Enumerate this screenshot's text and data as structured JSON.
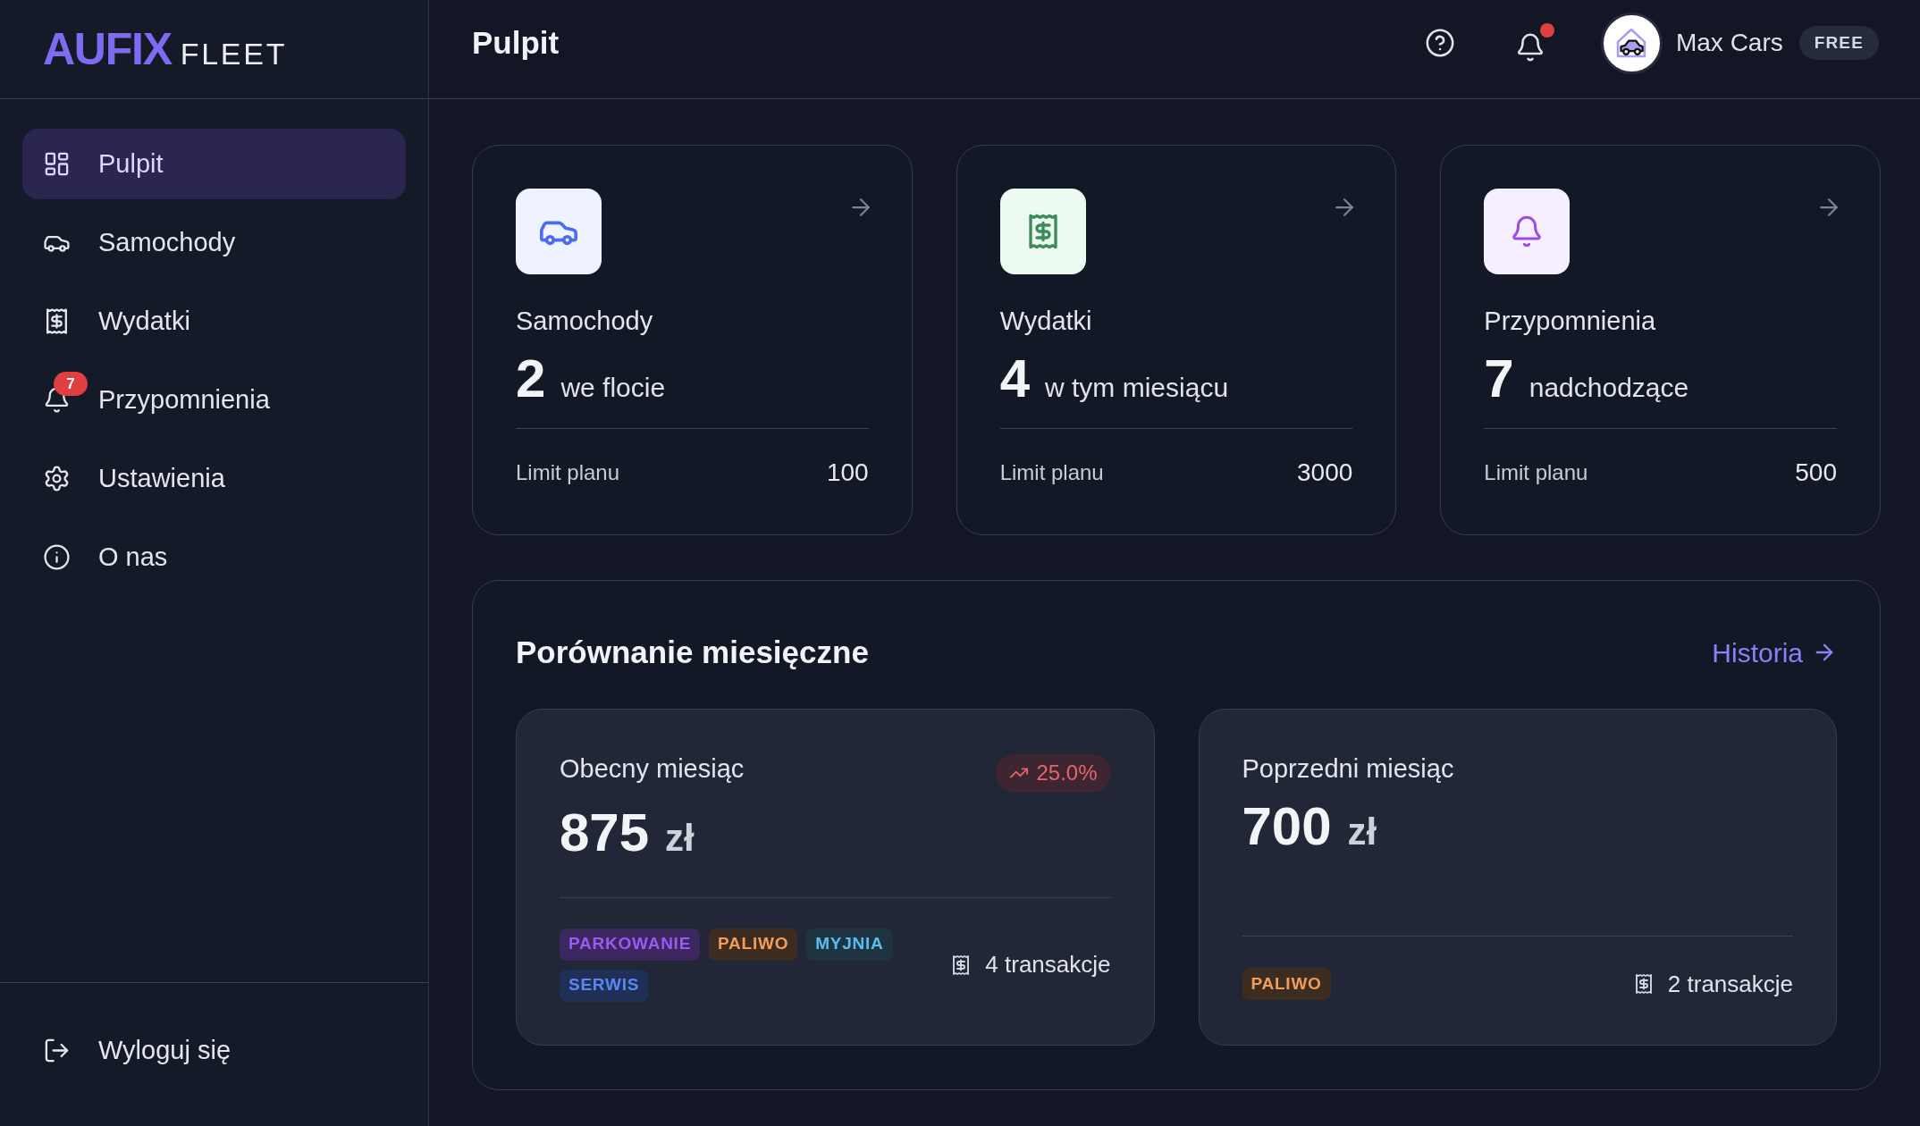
{
  "sidebar": {
    "logo": {
      "brand": "AUFIX",
      "product": "FLEET"
    },
    "items": [
      {
        "label": "Pulpit",
        "selected": true
      },
      {
        "label": "Samochody",
        "selected": false
      },
      {
        "label": "Wydatki",
        "selected": false
      },
      {
        "label": "Przypomnienia",
        "selected": false,
        "badge": "7"
      },
      {
        "label": "Ustawienia",
        "selected": false
      },
      {
        "label": "O nas",
        "selected": false
      }
    ],
    "logout": {
      "label": "Wyloguj się"
    }
  },
  "header": {
    "title": "Pulpit",
    "notifications": {
      "unread": true
    },
    "account": {
      "name": "Max Cars",
      "plan": "FREE"
    }
  },
  "stat_cards": [
    {
      "label": "Samochody",
      "value": "2",
      "caption": "we flocie",
      "limit_label": "Limit planu",
      "limit_value": "100"
    },
    {
      "label": "Wydatki",
      "value": "4",
      "caption": "w tym miesiącu",
      "limit_label": "Limit planu",
      "limit_value": "3000"
    },
    {
      "label": "Przypomnienia",
      "value": "7",
      "caption": "nadchodzące",
      "limit_label": "Limit planu",
      "limit_value": "500"
    }
  ],
  "comparison": {
    "title": "Porównanie miesięczne",
    "link": "Historia",
    "months": [
      {
        "label": "Obecny miesiąc",
        "amount": "875",
        "currency": "zł",
        "change": {
          "text": "25.0%",
          "kind": "increase"
        },
        "tags": [
          {
            "label": "PARKOWANIE",
            "color": "#3d275f"
          },
          {
            "label": "PALIWO",
            "color": "#3d2d21"
          },
          {
            "label": "MYJNIA",
            "color": "#1e3440"
          },
          {
            "label": "SERWIS",
            "color": "#1f2f55"
          }
        ],
        "transactions": "4 transakcje"
      },
      {
        "label": "Poprzedni miesiąc",
        "amount": "700",
        "currency": "zł",
        "tags": [
          {
            "label": "PALIWO",
            "color": "#3d2d21"
          }
        ],
        "transactions": "2 transakcje"
      }
    ]
  }
}
